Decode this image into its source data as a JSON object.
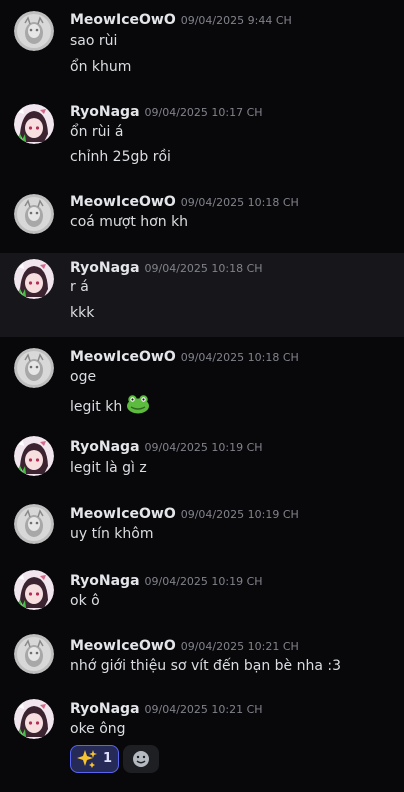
{
  "messages": [
    {
      "author": "MeowIceOwO",
      "timestamp": "09/04/2025 9:44 CH",
      "lines": [
        "sao rùi",
        "ổn khum"
      ]
    },
    {
      "author": "RyoNaga",
      "timestamp": "09/04/2025 10:17 CH",
      "lines": [
        "ổn rùi á",
        "chỉnh 25gb rồi"
      ]
    },
    {
      "author": "MeowIceOwO",
      "timestamp": "09/04/2025 10:18 CH",
      "lines": [
        "coá mượt hơn kh"
      ]
    },
    {
      "author": "RyoNaga",
      "timestamp": "09/04/2025 10:18 CH",
      "lines": [
        "r á",
        "kkk"
      ]
    },
    {
      "author": "MeowIceOwO",
      "timestamp": "09/04/2025 10:18 CH",
      "lines": [
        "oge",
        "legit kh"
      ]
    },
    {
      "author": "RyoNaga",
      "timestamp": "09/04/2025 10:19 CH",
      "lines": [
        "legit là gì z"
      ]
    },
    {
      "author": "MeowIceOwO",
      "timestamp": "09/04/2025 10:19 CH",
      "lines": [
        "uy tín khôm"
      ]
    },
    {
      "author": "RyoNaga",
      "timestamp": "09/04/2025 10:19 CH",
      "lines": [
        "ok ô"
      ]
    },
    {
      "author": "MeowIceOwO",
      "timestamp": "09/04/2025 10:21 CH",
      "lines": [
        "nhớ giới thiệu sơ vít đến bạn bè nha :3"
      ]
    },
    {
      "author": "RyoNaga",
      "timestamp": "09/04/2025 10:21 CH",
      "lines": [
        "oke ông"
      ]
    }
  ],
  "emoji": {
    "frog": "frog-emoji"
  },
  "reactions": [
    {
      "emoji": "sparkles-icon",
      "count": "1",
      "active": true
    },
    {
      "emoji": "add-reaction-icon",
      "active": false
    }
  ],
  "colors": {
    "background": "#08080b",
    "highlight": "#17171b",
    "username": "#e3e5e8",
    "timestamp": "#81838a",
    "text": "#dbdee1",
    "reaction_active_bg": "#262a57",
    "reaction_active_border": "#5865f2"
  }
}
